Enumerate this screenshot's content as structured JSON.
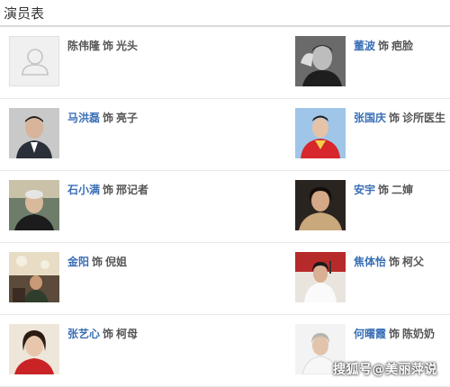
{
  "header": {
    "title": "演员表"
  },
  "cast": [
    {
      "actor": "陈伟隆",
      "connector": "饰",
      "role": "光头",
      "photo": "placeholder-avatar-icon",
      "linked": false
    },
    {
      "actor": "董波",
      "connector": "饰",
      "role": "疤脸",
      "photo": "actor-photo",
      "linked": true
    },
    {
      "actor": "马洪磊",
      "connector": "饰",
      "role": "亮子",
      "photo": "actor-photo",
      "linked": true
    },
    {
      "actor": "张国庆",
      "connector": "饰",
      "role": "诊所医生",
      "photo": "actor-photo",
      "linked": true
    },
    {
      "actor": "石小满",
      "connector": "饰",
      "role": "邢记者",
      "photo": "actor-photo",
      "linked": true
    },
    {
      "actor": "安宇",
      "connector": "饰",
      "role": "二婶",
      "photo": "actor-photo",
      "linked": true
    },
    {
      "actor": "金阳",
      "connector": "饰",
      "role": "倪姐",
      "photo": "actor-photo",
      "linked": true
    },
    {
      "actor": "焦体怡",
      "connector": "饰",
      "role": "柯父",
      "photo": "actor-photo",
      "linked": true
    },
    {
      "actor": "张艺心",
      "connector": "饰",
      "role": "柯母",
      "photo": "actor-photo",
      "linked": true
    },
    {
      "actor": "何曙霞",
      "connector": "饰",
      "role": "陈奶奶",
      "photo": "actor-photo",
      "linked": true
    }
  ],
  "watermark": "搜狐号@美丽萍说",
  "colors": {
    "link": "#3a6fb5",
    "text": "#555555",
    "divider": "#e8e8e8"
  }
}
